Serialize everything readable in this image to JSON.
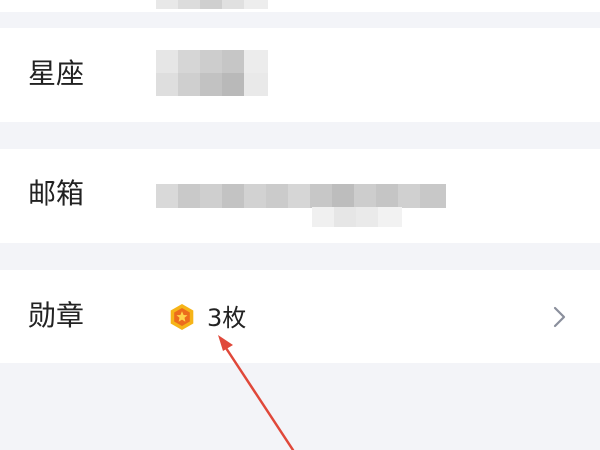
{
  "profile": {
    "rows": [
      {
        "label": "星座",
        "value": ""
      },
      {
        "label": "邮箱",
        "value": ""
      },
      {
        "label": "勋章",
        "value": "3枚"
      }
    ]
  },
  "colors": {
    "background": "#f3f4f8",
    "row": "#ffffff",
    "text": "#222222",
    "chevron": "#8a8f9c",
    "annotation_arrow": "#e0483a",
    "medal_outer": "#f6b418",
    "medal_inner": "#ec6c1c"
  },
  "icons": {
    "medal": "medal-star-icon",
    "chevron": "chevron-right-icon",
    "annotation": "arrow-annotation"
  }
}
